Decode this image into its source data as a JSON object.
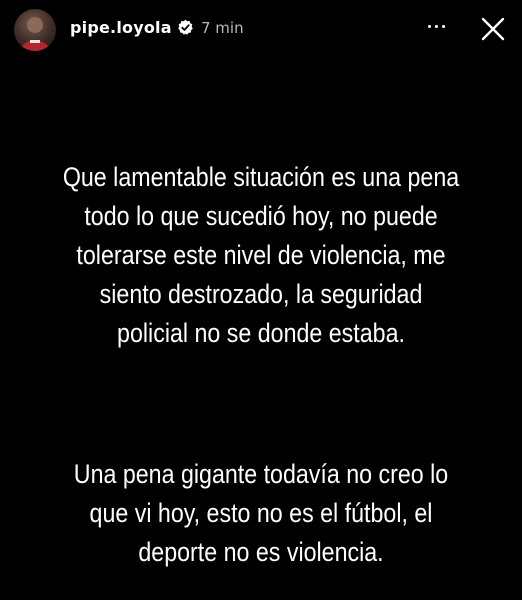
{
  "header": {
    "username": "pipe.loyola",
    "time": "7 min",
    "avatar_icon": "profile-avatar",
    "verified_icon": "verified-badge-icon",
    "more_icon": "more-options-icon",
    "close_icon": "close-icon",
    "verified_color": "#ffffff"
  },
  "story": {
    "paragraph1": "Que lamentable situación es una pena todo lo que sucedió hoy, no puede tolerarse este nivel de violencia, me siento destrozado, la seguridad policial no se donde estaba.",
    "paragraph2": "Una pena gigante todavía no creo lo que vi hoy, esto no es el fútbol, el deporte no es violencia."
  },
  "colors": {
    "background": "#000000",
    "text": "#ffffff",
    "muted_text": "#b9b9b9"
  }
}
